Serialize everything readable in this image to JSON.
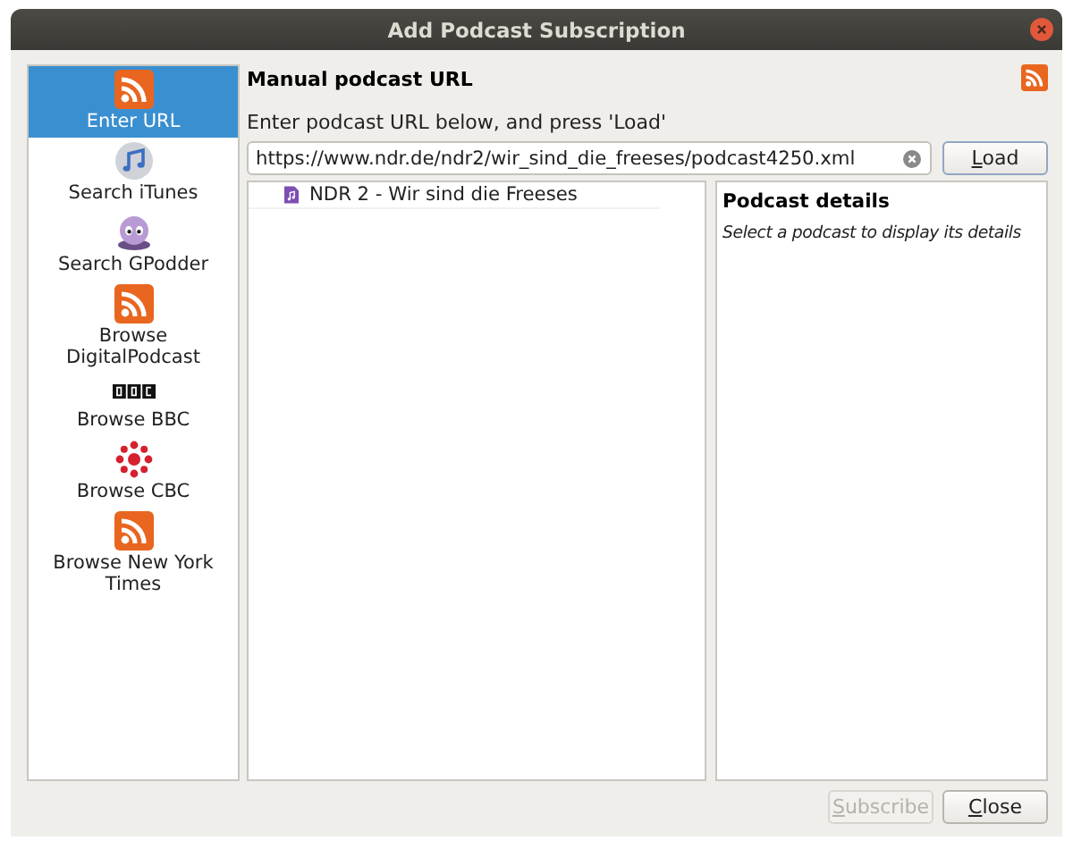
{
  "window": {
    "title": "Add Podcast Subscription"
  },
  "sources": [
    {
      "label": "Enter URL",
      "kind": "rss",
      "selected": true
    },
    {
      "label": "Search iTunes",
      "kind": "itunes",
      "selected": false
    },
    {
      "label": "Search GPodder",
      "kind": "gpodder",
      "selected": false
    },
    {
      "label": "Browse DigitalPodcast",
      "kind": "rss",
      "selected": false
    },
    {
      "label": "Browse BBC",
      "kind": "bbc",
      "selected": false
    },
    {
      "label": "Browse CBC",
      "kind": "cbc",
      "selected": false
    },
    {
      "label": "Browse New York Times",
      "kind": "rss",
      "selected": false
    }
  ],
  "heading": "Manual podcast URL",
  "instruction": "Enter podcast URL below, and press 'Load'",
  "url_field": {
    "value": "https://www.ndr.de/ndr2/wir_sind_die_freeses/podcast4250.xml"
  },
  "load_button": {
    "label": "Load",
    "mnemonic_underlined": true
  },
  "podcasts": [
    {
      "title": "NDR 2 - Wir sind die Freeses",
      "selected": false
    }
  ],
  "details": {
    "title": "Podcast details",
    "hint": "Select a podcast to display its details"
  },
  "buttons": [
    {
      "label": "Subscribe",
      "mnemonic_underlined": true,
      "disabled": true
    },
    {
      "label": "Close",
      "mnemonic_underlined": true,
      "disabled": false
    }
  ]
}
